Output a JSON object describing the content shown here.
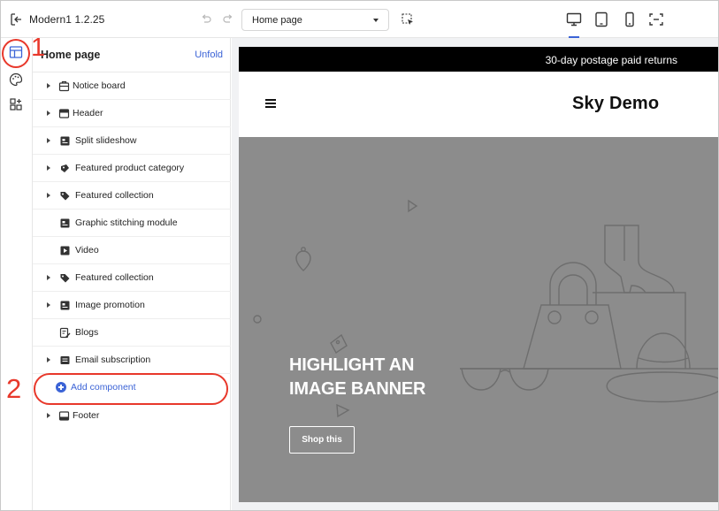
{
  "topbar": {
    "app_title": "Modern1  1.2.25",
    "page_select_value": "Home page"
  },
  "panel": {
    "title": "Home page",
    "unfold_label": "Unfold",
    "items": [
      {
        "label": "Notice board",
        "icon": "notice-icon",
        "expandable": true
      },
      {
        "label": "Header",
        "icon": "header-icon",
        "expandable": true
      },
      {
        "label": "Split slideshow",
        "icon": "image-icon",
        "expandable": true
      },
      {
        "label": "Featured product category",
        "icon": "palette-icon",
        "expandable": true
      },
      {
        "label": "Featured collection",
        "icon": "tag-icon",
        "expandable": true
      },
      {
        "label": "Graphic stitching module",
        "icon": "image-icon",
        "expandable": false
      },
      {
        "label": "Video",
        "icon": "play-icon",
        "expandable": false
      },
      {
        "label": "Featured collection",
        "icon": "tag-icon",
        "expandable": true
      },
      {
        "label": "Image promotion",
        "icon": "image-icon",
        "expandable": true
      },
      {
        "label": "Blogs",
        "icon": "edit-icon",
        "expandable": false
      },
      {
        "label": "Email subscription",
        "icon": "mail-icon",
        "expandable": true
      }
    ],
    "add_component_label": "Add component",
    "footer_label": "Footer"
  },
  "annotations": {
    "step1": "1",
    "step2": "2",
    "color": "#e8382b"
  },
  "preview": {
    "announcement": "30-day postage paid returns",
    "store_name": "Sky Demo",
    "headline_line1": "HIGHLIGHT AN",
    "headline_line2": "IMAGE BANNER",
    "shop_button": "Shop this",
    "banner_color": "#8c8c8c"
  },
  "colors": {
    "accent": "#3b63d6"
  }
}
